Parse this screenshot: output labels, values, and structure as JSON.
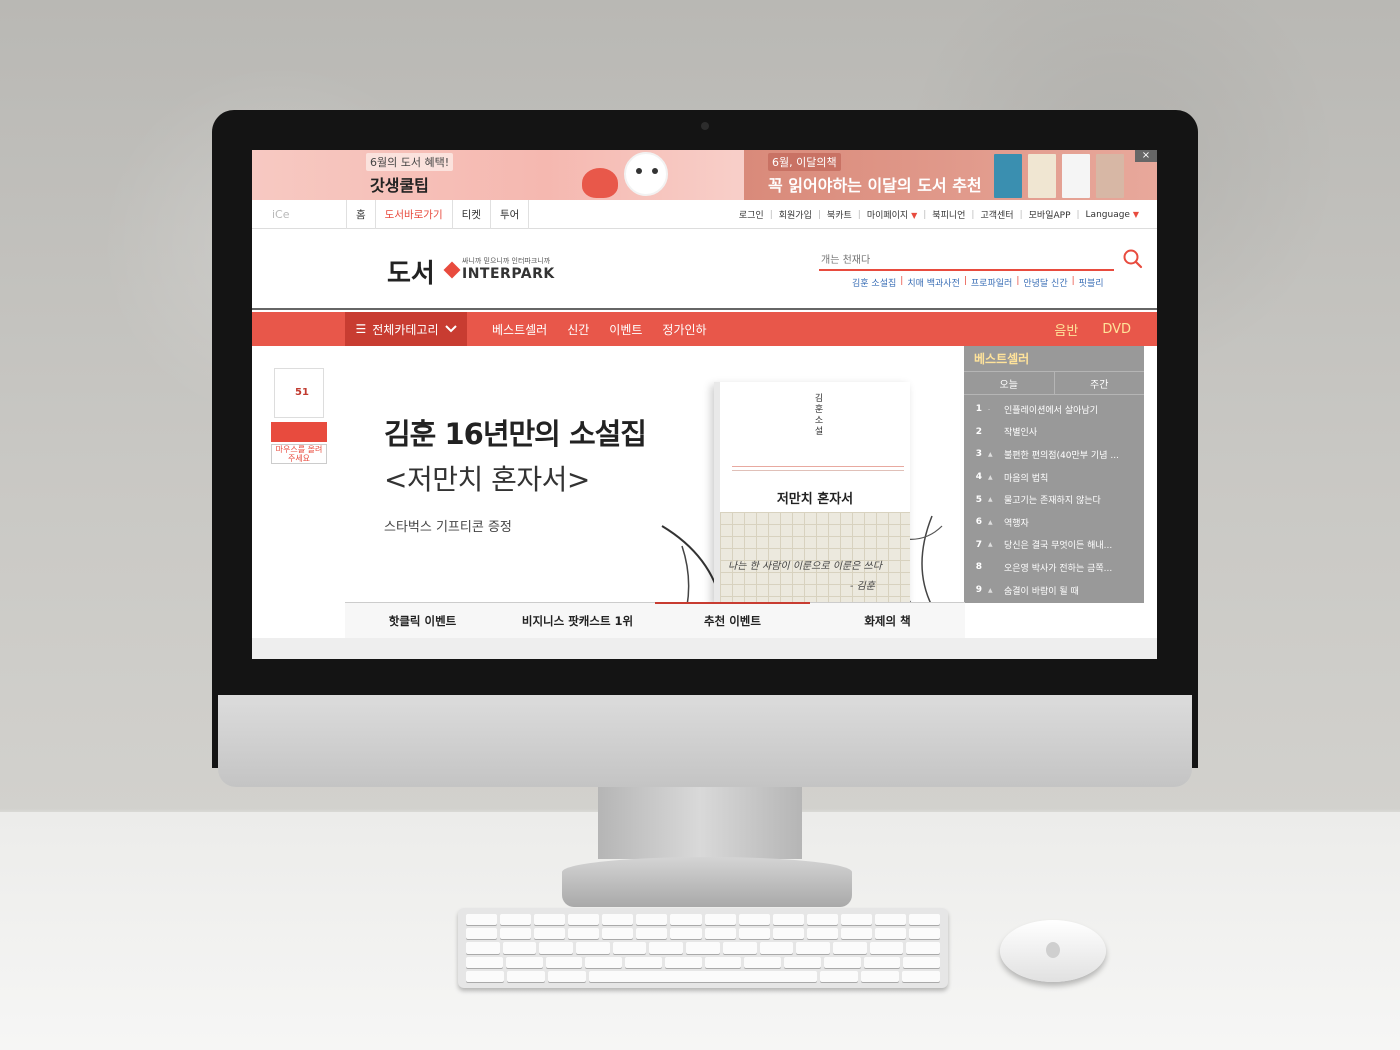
{
  "promo": {
    "left_small": "6월의 도서 혜택!",
    "left_big": "갓생쿨팁",
    "right_small": "6월, 이달의책",
    "right_big": "꼭 읽어야하는 이달의 도서 추천",
    "close": "×",
    "book_colors": [
      "#3a8fb0",
      "#f0e6d2",
      "#f5f5f5",
      "#d7b7a5"
    ]
  },
  "gnb": {
    "logo": "iCe",
    "tabs": [
      "홈",
      "도서바로가기",
      "티켓",
      "투어"
    ],
    "active_tab": "도서바로가기",
    "util": [
      "로그인",
      "회원가입",
      "북카트",
      "마이페이지",
      "북피니언",
      "고객센터",
      "모바일APP",
      "Language"
    ]
  },
  "header": {
    "logo_text": "도서",
    "slogan": "싸니까 믿으니까 인터파크니까",
    "brand": "INTERPARK",
    "search_placeholder": "개는 천재다",
    "keywords": [
      "김훈 소설집",
      "치매 백과사전",
      "프로파일러",
      "안녕달 신간",
      "핏블리"
    ]
  },
  "nav": {
    "category_label": "전체카테고리",
    "links": [
      "베스트셀러",
      "신간",
      "이벤트",
      "정가인하"
    ],
    "right_links": [
      "음반",
      "DVD"
    ]
  },
  "side_ad": {
    "book_title": "51",
    "text": "마우스를 올려 주세요"
  },
  "hero": {
    "title": "김훈 16년만의 소설집",
    "subtitle": "<저만치 혼자서>",
    "desc": "스타벅스 기프티콘 증정",
    "book_author": "김훈 소설",
    "book_name": "저만치 혼자서",
    "book_handwriting": "나는 한 사람이 이룬으로 이룬은 쓰다",
    "book_sign": "- 김훈"
  },
  "bestseller": {
    "title": "베스트셀러",
    "tabs": [
      "오늘",
      "주간"
    ],
    "items": [
      {
        "rank": "1",
        "name": "인플레이션에서 살아남기"
      },
      {
        "rank": "2",
        "name": "작별인사"
      },
      {
        "rank": "3",
        "name": "불편한 편의점(40만부 기념 ..."
      },
      {
        "rank": "4",
        "name": "마음의 법칙"
      },
      {
        "rank": "5",
        "name": "물고기는 존재하지 않는다"
      },
      {
        "rank": "6",
        "name": "역행자"
      },
      {
        "rank": "7",
        "name": "당신은 결국 무엇이든 해내..."
      },
      {
        "rank": "8",
        "name": "오은영 박사가 전하는 금쪽..."
      },
      {
        "rank": "9",
        "name": "숨결이 바람이 될 때"
      }
    ]
  },
  "bottom_tabs": [
    "핫클릭 이벤트",
    "비지니스 팟캐스트 1위",
    "추천 이벤트",
    "화제의 책"
  ],
  "active_bottom_tab": "추천 이벤트",
  "colors": {
    "accent": "#e84b3e",
    "nav_bg": "#e8574a",
    "category_bg": "#c83c31",
    "bestseller_bg": "#999999",
    "highlight_text": "#ffe39a"
  }
}
